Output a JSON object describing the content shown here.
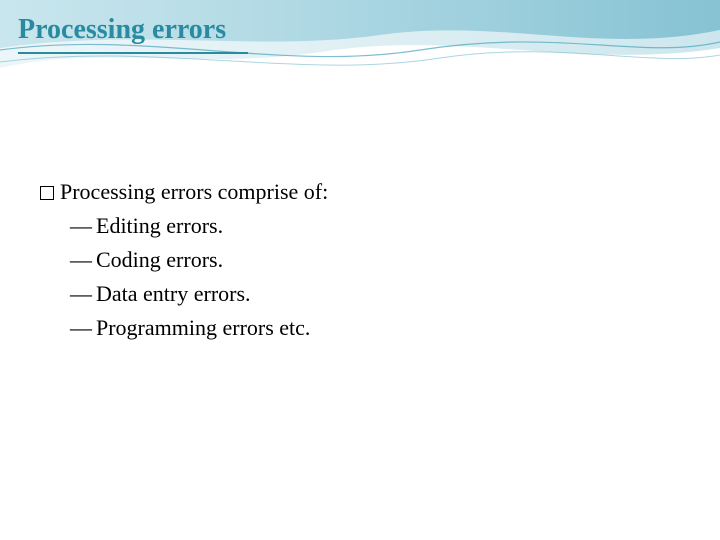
{
  "slide": {
    "title": "Processing errors",
    "intro": "Processing errors comprise of:",
    "items": [
      "Editing errors.",
      "Coding errors.",
      "Data entry errors.",
      "Programming errors etc."
    ]
  }
}
